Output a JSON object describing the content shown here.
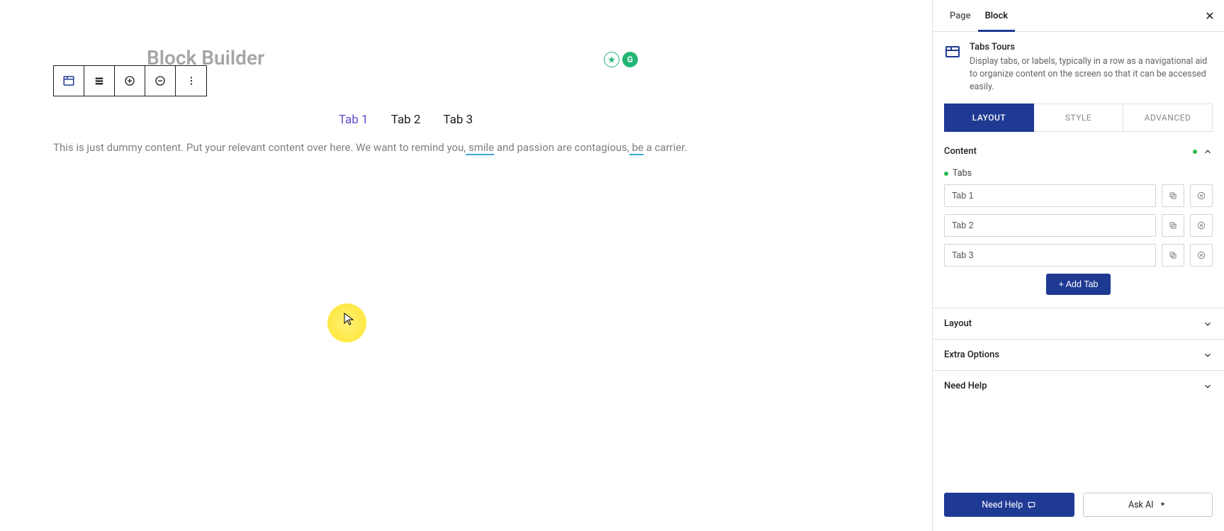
{
  "page_title": "Block Builder",
  "sidebar_tabs": {
    "page": "Page",
    "block": "Block"
  },
  "block_header": {
    "title": "Tabs Tours",
    "desc": "Display tabs, or labels, typically in a row as a navigational aid to organize content on the screen so that it can be accessed easily."
  },
  "inner_tabs": {
    "layout": "LAYOUT",
    "style": "STYLE",
    "advanced": "ADVANCED"
  },
  "content_section_label": "Content",
  "tabs_field_label": "Tabs",
  "tab_names": [
    "Tab 1",
    "Tab 2",
    "Tab 3"
  ],
  "add_tab_label": "+ Add Tab",
  "collapsible_sections": [
    "Layout",
    "Extra Options",
    "Need Help"
  ],
  "footer": {
    "need_help": "Need Help",
    "ask_ai": "Ask AI"
  },
  "canvas": {
    "tabs": [
      "Tab 1",
      "Tab 2",
      "Tab 3"
    ],
    "text_parts": {
      "a": "This is just dummy content. Put your relevant content over here. We want to remind you,",
      "b": " smile",
      "c": " and passion are contagious,",
      "d": " be",
      "e": " a carrier."
    }
  }
}
